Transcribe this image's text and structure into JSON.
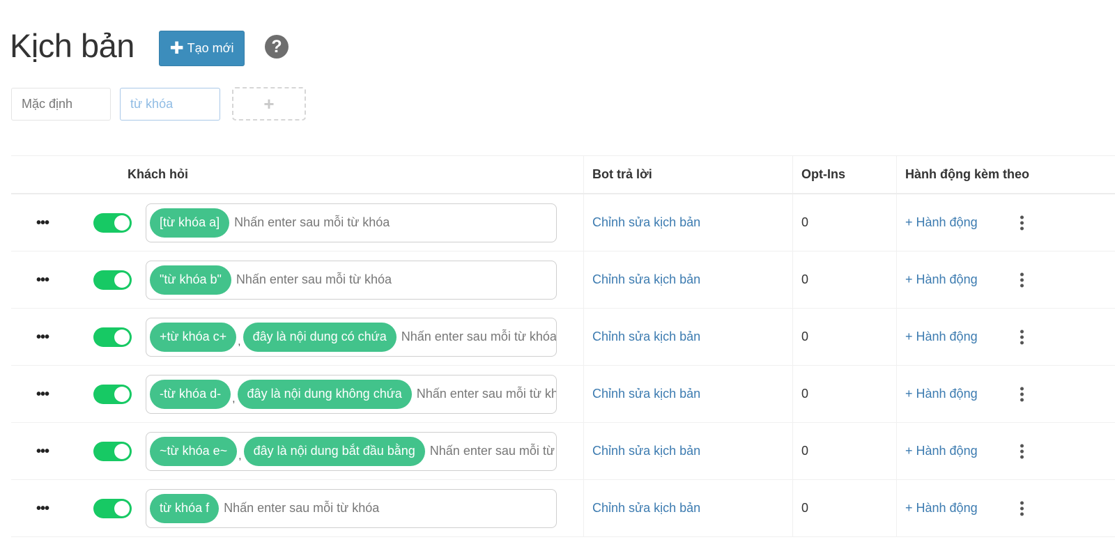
{
  "header": {
    "title": "Kịch bản",
    "create_button": "Tạo mới",
    "create_icon": "plus-icon",
    "help_icon": "question-circle-icon"
  },
  "filters": {
    "default_label": "Mặc định",
    "keyword_label": "từ khóa",
    "add_icon": "plus-icon"
  },
  "table": {
    "headers": {
      "question": "Khách hỏi",
      "bot_reply": "Bot trả lời",
      "opt_ins": "Opt-Ins",
      "actions": "Hành động kèm theo"
    },
    "placeholder": "Nhấn enter sau mỗi từ khóa",
    "rows": [
      {
        "enabled": true,
        "tags": [
          "[từ khóa a]"
        ],
        "bot_reply": "Chỉnh sửa kịch bản",
        "opt_ins": "0",
        "action": "+ Hành động"
      },
      {
        "enabled": true,
        "tags": [
          "\"từ khóa b\""
        ],
        "bot_reply": "Chỉnh sửa kịch bản",
        "opt_ins": "0",
        "action": "+ Hành động"
      },
      {
        "enabled": true,
        "tags": [
          "+từ khóa c+",
          "đây là nội dung có chứa"
        ],
        "bot_reply": "Chỉnh sửa kịch bản",
        "opt_ins": "0",
        "action": "+ Hành động"
      },
      {
        "enabled": true,
        "tags": [
          "-từ khóa d-",
          "đây là nội dung không chứa"
        ],
        "bot_reply": "Chỉnh sửa kịch bản",
        "opt_ins": "0",
        "action": "+ Hành động"
      },
      {
        "enabled": true,
        "tags": [
          "~từ khóa e~",
          "đây là nội dung bắt đầu bằng"
        ],
        "bot_reply": "Chỉnh sửa kịch bản",
        "opt_ins": "0",
        "action": "+ Hành động"
      },
      {
        "enabled": true,
        "tags": [
          "từ khóa f"
        ],
        "bot_reply": "Chỉnh sửa kịch bản",
        "opt_ins": "0",
        "action": "+ Hành động"
      }
    ]
  },
  "colors": {
    "primary_button": "#3c8dbc",
    "toggle_on": "#17c964",
    "tag": "#42c38b",
    "link": "#3c7bb0"
  }
}
